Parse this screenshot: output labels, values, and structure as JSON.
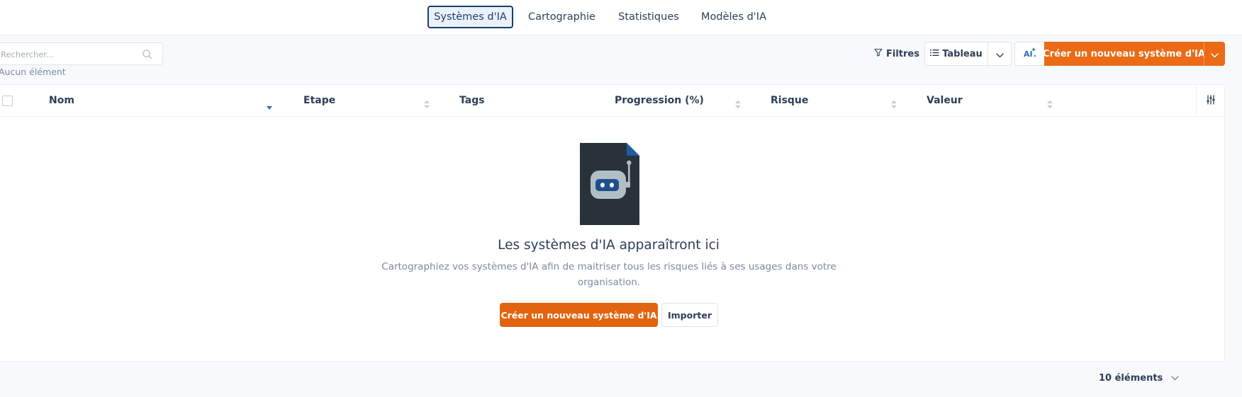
{
  "tabs": [
    {
      "label": "Systèmes d'IA",
      "active": true
    },
    {
      "label": "Cartographie",
      "active": false
    },
    {
      "label": "Statistiques",
      "active": false
    },
    {
      "label": "Modèles d'IA",
      "active": false
    }
  ],
  "toolbar": {
    "search_placeholder": "Rechercher...",
    "search_icon": "search-icon",
    "count_label": "Aucun élément",
    "filters_label": "Filtres",
    "view_label": "Tableau",
    "ai_icon": "ai-sparkle-icon",
    "create_label": "Créer un nouveau système d'IA"
  },
  "table": {
    "columns": [
      "Nom",
      "Etape",
      "Tags",
      "Progression (%)",
      "Risque",
      "Valeur"
    ],
    "sorted_column": "Nom"
  },
  "empty_state": {
    "title": "Les systèmes d'IA apparaîtront ici",
    "description": "Cartographiez vos systèmes d'IA afin de maitriser tous les risques liés à ses usages dans votre organisation.",
    "cta_label": "Créer un nouveau système d'IA",
    "import_label": "Importer"
  },
  "footer": {
    "page_size_label": "10 éléments"
  },
  "colors": {
    "accent": "#ea6a15",
    "active_tab": "#1b3f6b",
    "text": "#2d3e56",
    "muted": "#7a8aa0"
  }
}
